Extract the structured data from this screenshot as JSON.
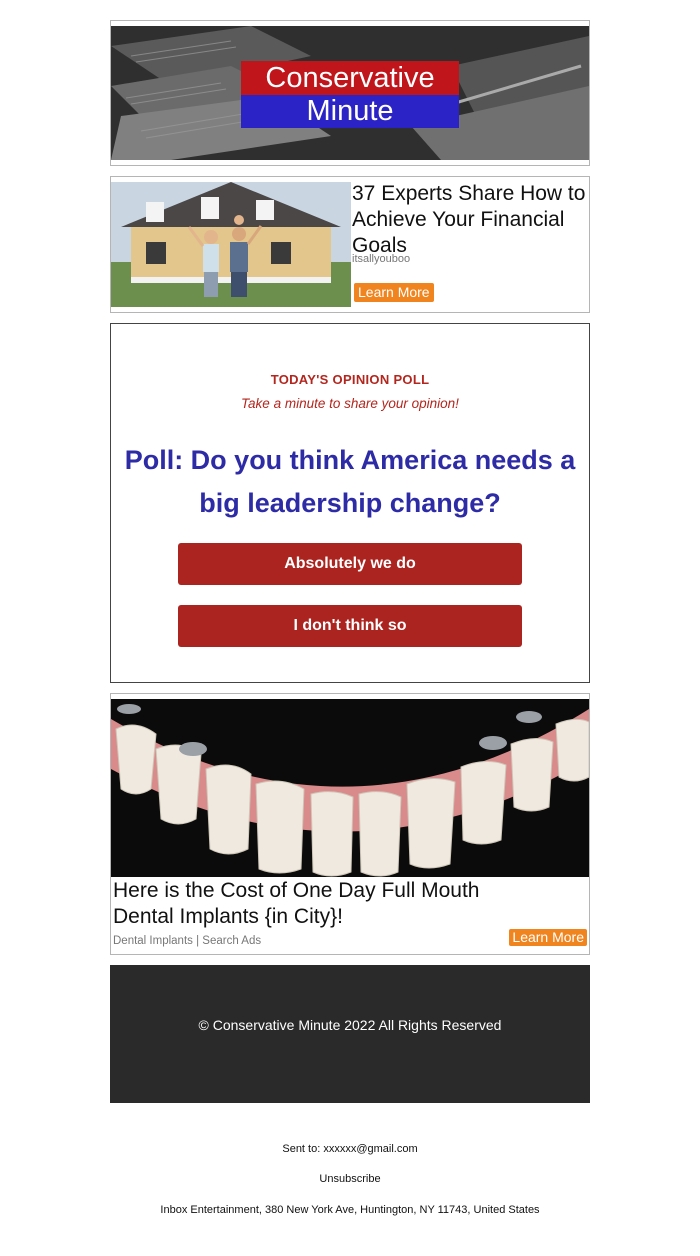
{
  "header": {
    "logo_line1": "Conservative",
    "logo_line2": "Minute"
  },
  "ad1": {
    "title": "37 Experts Share How to Achieve Your Financial Goals",
    "source": "itsallyouboo",
    "cta": "Learn More"
  },
  "poll": {
    "kicker": "TODAY'S OPINION POLL",
    "subtitle": "Take a minute to share your opinion!",
    "question": "Poll: Do you think America needs a big leadership change?",
    "option_yes": "Absolutely we do",
    "option_no": "I don't think so"
  },
  "ad2": {
    "title": "Here is the Cost of One Day Full Mouth Dental Implants {in City}!",
    "source": "Dental Implants | Search Ads",
    "cta": "Learn More"
  },
  "footer": {
    "copyright": "© Conservative Minute 2022 All Rights Reserved"
  },
  "meta": {
    "sent_to": "Sent to: xxxxxx@gmail.com",
    "unsubscribe": "Unsubscribe",
    "address": "Inbox Entertainment, 380 New York Ave, Huntington, NY 11743, United States"
  },
  "colors": {
    "brand_red": "#c0151b",
    "brand_blue": "#2b23c6",
    "poll_button": "#ac2420",
    "question_blue": "#2d2ba5",
    "cta_orange": "#f0841f"
  }
}
